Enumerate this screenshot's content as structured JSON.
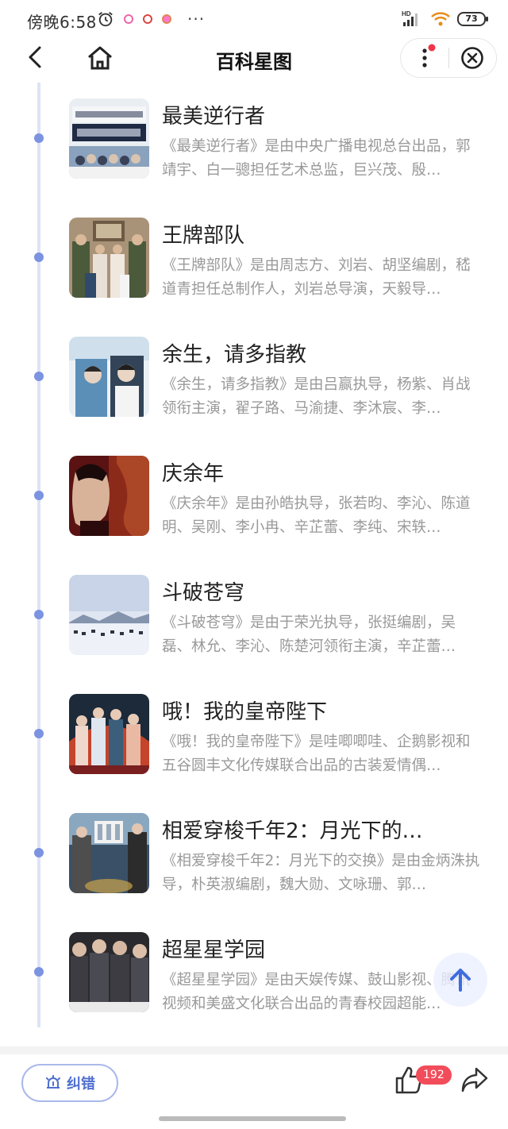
{
  "status_bar": {
    "time": "傍晚6:58",
    "more": "···",
    "network": "HD",
    "battery": "73"
  },
  "nav": {
    "title": "百科星图"
  },
  "items": [
    {
      "title": "最美逆行者",
      "desc": "《最美逆行者》是由中央广播电视总台出品，郭靖宇、白一骢担任艺术总监，巨兴茂、殷…"
    },
    {
      "title": "王牌部队",
      "desc": "《王牌部队》是由周志方、刘岩、胡坚编剧，嵇道青担任总制作人，刘岩总导演，天毅导…"
    },
    {
      "title": "余生，请多指教",
      "desc": "《余生，请多指教》是由吕赢执导，杨紫、肖战领衔主演，翟子路、马渝捷、李沐宸、李…"
    },
    {
      "title": "庆余年",
      "desc": "《庆余年》是由孙皓执导，张若昀、李沁、陈道明、吴刚、李小冉、辛芷蕾、李纯、宋轶…"
    },
    {
      "title": "斗破苍穹",
      "desc": "《斗破苍穹》是由于荣光执导，张挺编剧，吴磊、林允、李沁、陈楚河领衔主演，辛芷蕾…"
    },
    {
      "title": "哦！我的皇帝陛下",
      "desc": "《哦！我的皇帝陛下》是哇唧唧哇、企鹅影视和五谷圆丰文化传媒联合出品的古装爱情偶…"
    },
    {
      "title": "相爱穿梭千年2：月光下的…",
      "desc": "《相爱穿梭千年2：月光下的交换》是由金炳洙执导，朴英淑编剧，魏大勋、文咏珊、郭…"
    },
    {
      "title": "超星星学园",
      "desc": "《超星星学园》是由天娱传媒、鼓山影视、腾讯视频和美盛文化联合出品的青春校园超能…"
    }
  ],
  "bottom_bar": {
    "correct_label": "纠错",
    "like_count": "192"
  },
  "colors": {
    "accent": "#4f6fd0",
    "timeline_dot": "#7b93e0",
    "badge": "#f24c5a"
  },
  "icons": [
    "back-icon",
    "home-icon",
    "more-vertical-icon",
    "close-circle-icon",
    "alarm-clock-icon",
    "arrow-up-icon",
    "thumbs-up-icon",
    "share-icon",
    "alert-icon"
  ]
}
